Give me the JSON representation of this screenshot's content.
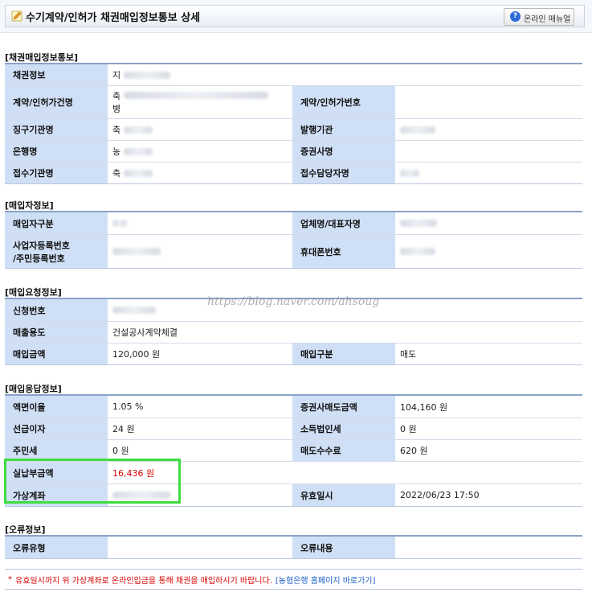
{
  "header": {
    "title": "수기계약/인허가 채권매입정보통보 상세",
    "manual_button": "온라인 매뉴얼"
  },
  "sections": {
    "bond_notice": {
      "title": "[채권매입정보통보]",
      "bond_info_label": "채권정보",
      "bond_info_value": "지",
      "contract_name_label": "계약/인허가건명",
      "contract_name_value": "축",
      "contract_name_value2": "병",
      "contract_no_label": "계약/인허가번호",
      "contract_no_value": "",
      "collect_agency_label": "징구기관명",
      "collect_agency_value": "축",
      "issuer_label": "발행기관",
      "issuer_value": "",
      "bank_label": "은행명",
      "bank_value": "농",
      "securities_label": "증권사명",
      "securities_value": "",
      "receive_agency_label": "접수기관명",
      "receive_agency_value": "축",
      "receive_manager_label": "접수담당자명",
      "receive_manager_value": ""
    },
    "buyer": {
      "title": "[매입자정보]",
      "buyer_type_label": "매입자구분",
      "buyer_type_value": "",
      "company_label": "업체명/대표자명",
      "company_value": "",
      "reg_no_label_1": "사업자등록번호",
      "reg_no_label_2": "/주민등록번호",
      "reg_no_value": "",
      "mobile_label": "휴대폰번호",
      "mobile_value": ""
    },
    "request": {
      "title": "[매입요청정보]",
      "apply_no_label": "신청번호",
      "apply_no_value": "",
      "usage_label": "매출용도",
      "usage_value": "건설공사계약체결",
      "amount_label": "매입금액",
      "amount_value": "120,000 원",
      "type_label": "매입구분",
      "type_value": "매도"
    },
    "response": {
      "title": "[매입응답정보]",
      "face_rate_label": "액면이율",
      "face_rate_value": "1.05 %",
      "sell_amount_label": "증권사매도금액",
      "sell_amount_value": "104,160 원",
      "prepaid_interest_label": "선급이자",
      "prepaid_interest_value": "24 원",
      "income_tax_label": "소득법인세",
      "income_tax_value": "0 원",
      "resident_tax_label": "주민세",
      "resident_tax_value": "0 원",
      "sell_fee_label": "매도수수료",
      "sell_fee_value": "620 원",
      "actual_pay_label": "실납부금액",
      "actual_pay_value": "16,436 원",
      "virtual_account_label": "가상계좌",
      "virtual_account_value": "",
      "valid_until_label": "유효일시",
      "valid_until_value": "2022/06/23 17:50"
    },
    "error": {
      "title": "[오류정보]",
      "error_type_label": "오류유형",
      "error_type_value": "",
      "error_content_label": "오류내용",
      "error_content_value": ""
    }
  },
  "notice": {
    "star": "*",
    "text": "유효일시까지 위 가상계좌로 온라인입금을 통해 채권을 매입하시기 바랍니다.",
    "link": "[농협은행 홈페이지 바로가기]"
  },
  "watermark": "https://blog.naver.com/ahsoug",
  "colors": {
    "label_bg": "#cfdff5",
    "highlight": "#3fdc3f",
    "warning_text": "#d80000",
    "link": "#1d5fc8"
  }
}
